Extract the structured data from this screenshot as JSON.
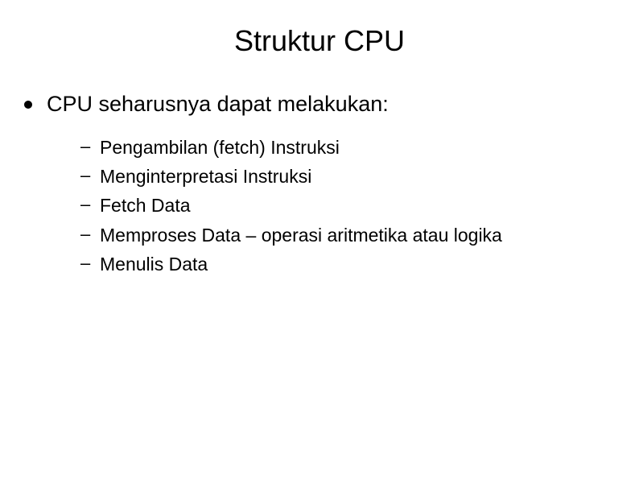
{
  "slide": {
    "title": "Struktur CPU",
    "main_bullet": "CPU seharusnya dapat melakukan:",
    "sub_bullets": {
      "item0": "Pengambilan (fetch) Instruksi",
      "item1": "Menginterpretasi Instruksi",
      "item2": "Fetch Data",
      "item3": "Memproses Data – operasi aritmetika atau logika",
      "item4": "Menulis Data"
    }
  }
}
